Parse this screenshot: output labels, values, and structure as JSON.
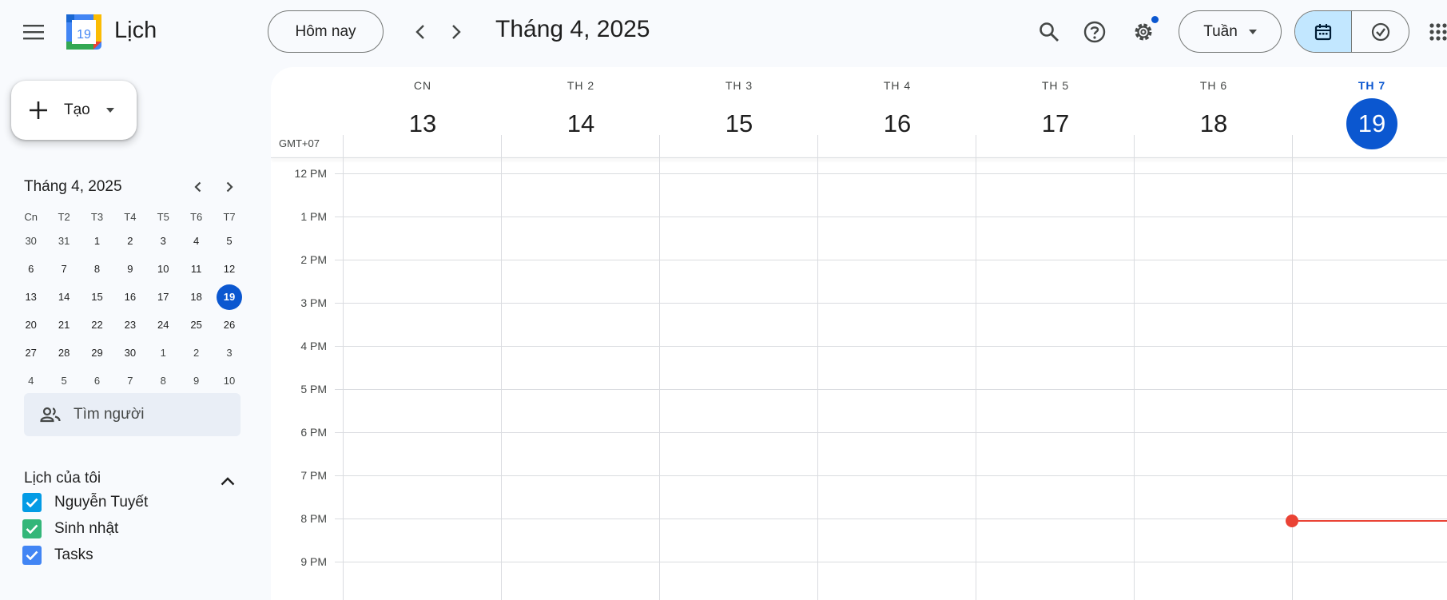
{
  "app": {
    "title": "Lịch",
    "logo_day": "19"
  },
  "toolbar": {
    "today_label": "Hôm nay",
    "month_title": "Tháng 4, 2025",
    "view_label": "Tuần"
  },
  "sidebar": {
    "create_label": "Tạo",
    "mini_cal": {
      "title": "Tháng 4, 2025",
      "weekdays": [
        "Cn",
        "T2",
        "T3",
        "T4",
        "T5",
        "T6",
        "T7"
      ],
      "weeks": [
        [
          "30",
          "31",
          "1",
          "2",
          "3",
          "4",
          "5"
        ],
        [
          "6",
          "7",
          "8",
          "9",
          "10",
          "11",
          "12"
        ],
        [
          "13",
          "14",
          "15",
          "16",
          "17",
          "18",
          "19"
        ],
        [
          "20",
          "21",
          "22",
          "23",
          "24",
          "25",
          "26"
        ],
        [
          "27",
          "28",
          "29",
          "30",
          "1",
          "2",
          "3"
        ],
        [
          "4",
          "5",
          "6",
          "7",
          "8",
          "9",
          "10"
        ]
      ],
      "today": "19"
    },
    "search_people_placeholder": "Tìm người",
    "my_calendars_title": "Lịch của tôi",
    "calendars": [
      {
        "label": "Nguyễn Tuyết",
        "color": "#039be5"
      },
      {
        "label": "Sinh nhật",
        "color": "#33b679"
      },
      {
        "label": "Tasks",
        "color": "#4285f4"
      }
    ]
  },
  "week": {
    "timezone": "GMT+07",
    "days": [
      {
        "name": "CN",
        "num": "13"
      },
      {
        "name": "TH 2",
        "num": "14"
      },
      {
        "name": "TH 3",
        "num": "15"
      },
      {
        "name": "TH 4",
        "num": "16"
      },
      {
        "name": "TH 5",
        "num": "17"
      },
      {
        "name": "TH 6",
        "num": "18"
      },
      {
        "name": "TH 7",
        "num": "19",
        "today": true
      }
    ],
    "hours": [
      "12 PM",
      "1 PM",
      "2 PM",
      "3 PM",
      "4 PM",
      "5 PM",
      "6 PM",
      "7 PM",
      "8 PM",
      "9 PM"
    ]
  },
  "colors": {
    "accent": "#0b57d0",
    "now_indicator": "#ea4335",
    "toggle_active": "#c2e7ff"
  }
}
